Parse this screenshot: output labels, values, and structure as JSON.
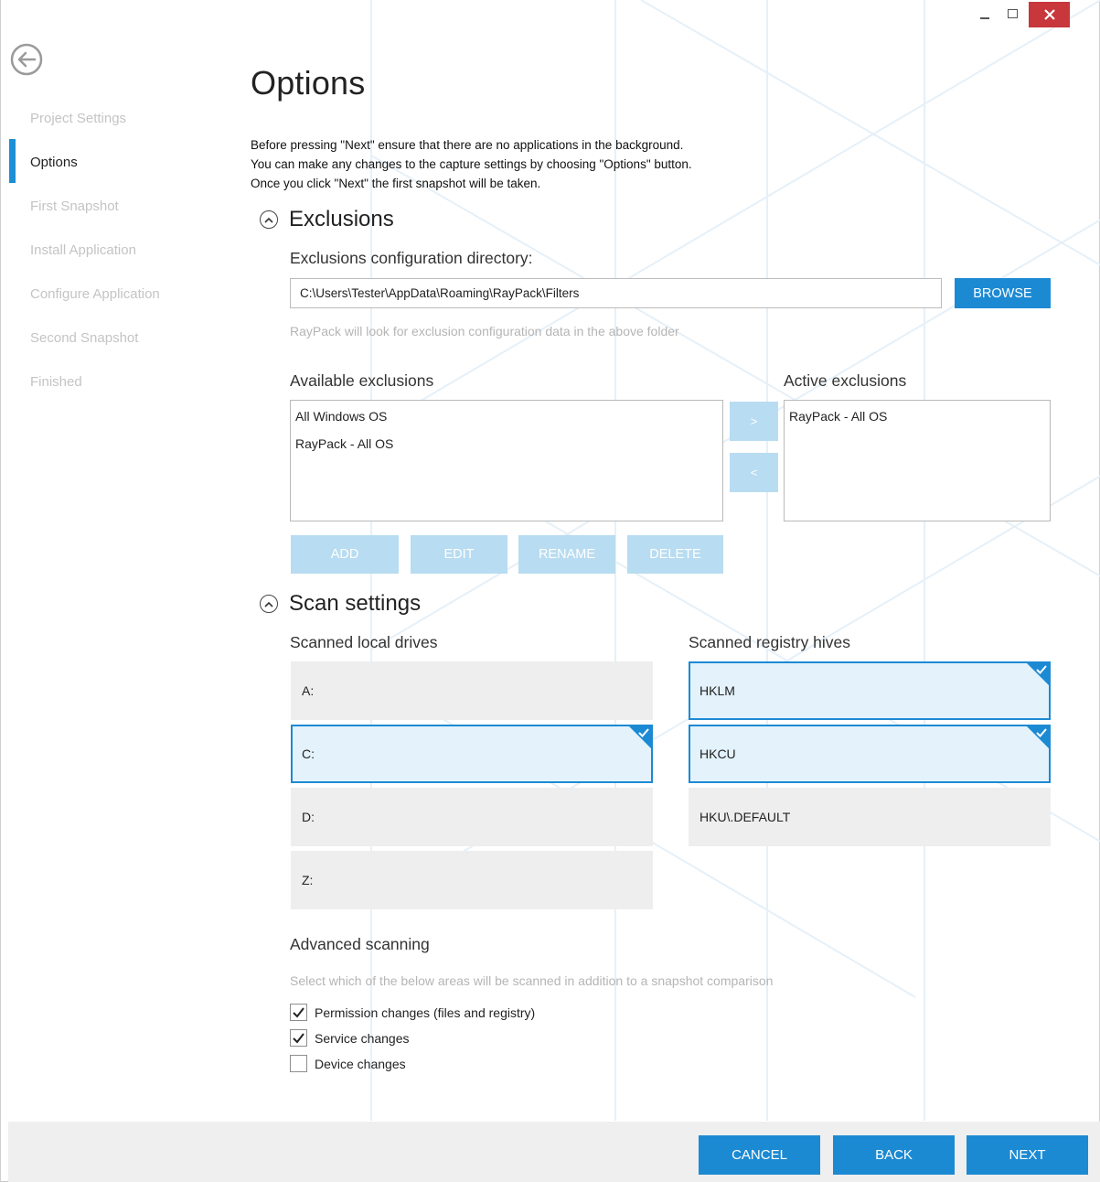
{
  "window": {
    "minimize": "minimize-icon",
    "maximize": "maximize-icon",
    "close": "close-icon"
  },
  "nav": {
    "back_icon": "back-arrow-icon",
    "items": [
      {
        "label": "Project Settings",
        "state": "inactive"
      },
      {
        "label": "Options",
        "state": "active"
      },
      {
        "label": "First Snapshot",
        "state": "inactive"
      },
      {
        "label": "Install Application",
        "state": "inactive"
      },
      {
        "label": "Configure Application",
        "state": "inactive"
      },
      {
        "label": "Second Snapshot",
        "state": "inactive"
      },
      {
        "label": "Finished",
        "state": "inactive"
      }
    ]
  },
  "page": {
    "title": "Options",
    "intro_lines": [
      "Before pressing \"Next\" ensure that there are no applications in the background.",
      "You can make any changes to the capture settings by choosing \"Options\" button.",
      "Once you click \"Next\" the first snapshot will be taken."
    ]
  },
  "exclusions": {
    "heading": "Exclusions",
    "dir_label": "Exclusions configuration directory:",
    "dir_value": "C:\\Users\\Tester\\AppData\\Roaming\\RayPack\\Filters",
    "browse_label": "BROWSE",
    "dir_hint": "RayPack will look for exclusion configuration data in the above folder",
    "available_label": "Available exclusions",
    "available_items": [
      "All Windows OS",
      "RayPack - All OS"
    ],
    "active_label": "Active exclusions",
    "active_items": [
      "RayPack - All OS"
    ],
    "move_right": ">",
    "move_left": "<",
    "add_label": "ADD",
    "edit_label": "EDIT",
    "rename_label": "RENAME",
    "delete_label": "DELETE"
  },
  "scan": {
    "heading": "Scan settings",
    "drives_label": "Scanned local drives",
    "drives": [
      {
        "label": "A:",
        "selected": false
      },
      {
        "label": "C:",
        "selected": true
      },
      {
        "label": "D:",
        "selected": false
      },
      {
        "label": "Z:",
        "selected": false
      }
    ],
    "hives_label": "Scanned registry hives",
    "hives": [
      {
        "label": "HKLM",
        "selected": true
      },
      {
        "label": "HKCU",
        "selected": true
      },
      {
        "label": "HKU\\.DEFAULT",
        "selected": false
      }
    ]
  },
  "advanced": {
    "heading": "Advanced scanning",
    "hint": "Select which of the below areas will be scanned in addition to a snapshot comparison",
    "options": [
      {
        "label": "Permission changes (files and registry)",
        "checked": true
      },
      {
        "label": "Service changes",
        "checked": true
      },
      {
        "label": "Device changes",
        "checked": false
      }
    ]
  },
  "footer": {
    "cancel_label": "CANCEL",
    "back_label": "BACK",
    "next_label": "NEXT"
  },
  "colors": {
    "accent": "#1c8ad3",
    "accent_light": "#b8dcf1",
    "selected_tile": "#e3f2fb",
    "close_red": "#c7373c"
  }
}
